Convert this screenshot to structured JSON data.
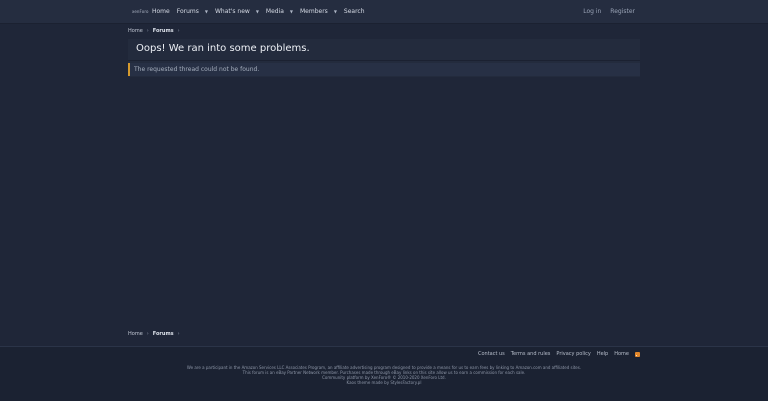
{
  "site": {
    "logo_text": "xenForo"
  },
  "nav": {
    "items": [
      {
        "label": "Home",
        "has_menu": false
      },
      {
        "label": "Forums",
        "has_menu": true
      },
      {
        "label": "What's new",
        "has_menu": true
      },
      {
        "label": "Media",
        "has_menu": true
      },
      {
        "label": "Members",
        "has_menu": true
      },
      {
        "label": "Search",
        "has_menu": false
      }
    ],
    "login_label": "Log in",
    "register_label": "Register",
    "caret_icon": "chevron-down-icon"
  },
  "breadcrumb": {
    "items": [
      "Home",
      "Forums"
    ],
    "separator": "›"
  },
  "main": {
    "title": "Oops! We ran into some problems.",
    "error_message": "The requested thread could not be found."
  },
  "footer": {
    "links": [
      "Contact us",
      "Terms and rules",
      "Privacy policy",
      "Help",
      "Home"
    ],
    "rss_icon": "rss-icon",
    "lines": [
      "We are a participant in the Amazon Services LLC Associates Program, an affiliate advertising program designed to provide a means for us to earn fees by linking to Amazon.com and affiliated sites.",
      "This forum is an eBay Partner Network member. Purchases made through eBay links on this site allow us to earn a commission for each sale.",
      "Community platform by XenForo® © 2010-2020 XenForo Ltd.",
      "Kaos theme made by StylesFactory.pl"
    ]
  },
  "colors": {
    "background": "#1f2638",
    "topbar": "#252d40",
    "notice_accent": "#d59a2e",
    "rss": "#e2872a"
  }
}
